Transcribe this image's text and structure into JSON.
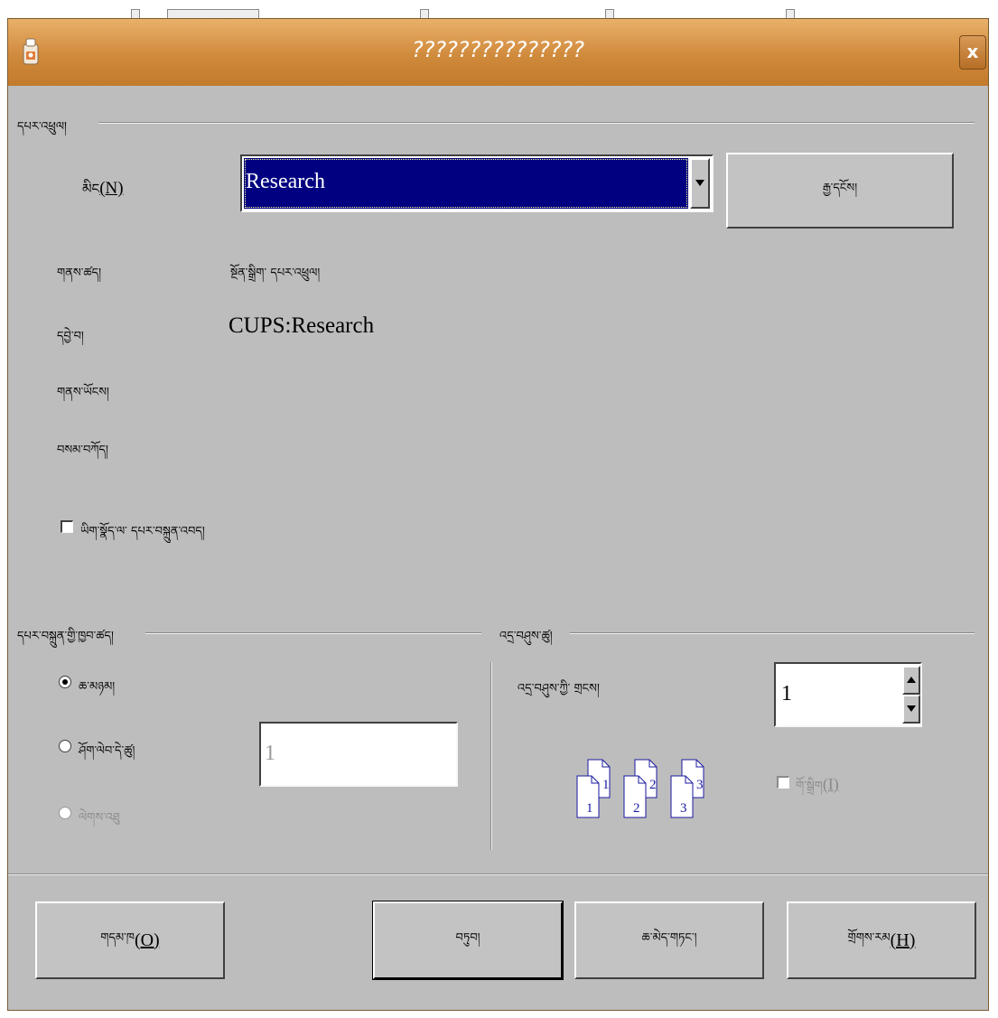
{
  "window": {
    "title": "???????????????",
    "close_label": "x"
  },
  "printer": {
    "section_label": "དཔར་འཕྲུལ།",
    "name_label": "མིང",
    "name_hotkey": "(N)",
    "name_value": "Research",
    "properties_button": "རྒྱ་དངོས།",
    "status_label": "གནས་ཚད།",
    "status_value": "སྔོན་སྒྲིག་ དཔར་འཕྲུལ།",
    "type_label": "དབྱེ་བ།",
    "type_value": "CUPS:Research",
    "location_label": "གནས་ཡོངས།",
    "comment_label": "བསམ་བཀོད།",
    "print_to_file_label": "ཡིག་སྣོད་ལ་ དཔར་བསྐྲུན་འབད།",
    "print_to_file_checked": false
  },
  "print_range": {
    "section_label": "དཔར་བསྐྲུན་གྱི་ཁྱབ་ཚད།",
    "all_label": "ཆ་མཉམ།",
    "pages_label": "ཤོག་ལེབ་དེ་ཚུ།",
    "pages_value": "1",
    "selection_label": "ལེགས་འཐུ",
    "selected": "all"
  },
  "copies": {
    "section_label": "འདྲ་བཤུས་ཚུ།",
    "count_label": "འདྲ་བཤུས་ཀྱི་ གྲངས།",
    "count_value": "1",
    "collate_label": "གོ་སྒྲིག",
    "collate_hotkey": "(I)",
    "collate_checked": false,
    "page_numbers": [
      "1",
      "1",
      "2",
      "2",
      "3",
      "3"
    ]
  },
  "buttons": {
    "options_label": "གདམ་ཁ",
    "options_hotkey": "(O)",
    "ok_label": "བཏུབ།",
    "cancel_label": "ཆ་མེད་གཏང་།",
    "help_label": "གྲོགས་རམ",
    "help_hotkey": "(H)"
  },
  "colors": {
    "titlebar": "#d08a3c",
    "dialog_bg": "#bdbdbd",
    "selection_bg": "#000080",
    "selection_text": "#ffffff",
    "page_number": "#1a1aa0"
  },
  "icons": {
    "app": "application-icon",
    "close": "close-icon",
    "dropdown": "chevron-down-icon",
    "spin_up": "arrow-up-icon",
    "spin_down": "arrow-down-icon",
    "collate_preview": "stacked-pages-icon"
  }
}
